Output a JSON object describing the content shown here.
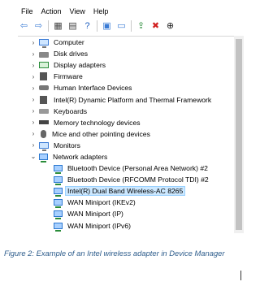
{
  "menu": [
    "File",
    "Action",
    "View",
    "Help"
  ],
  "toolbar": [
    {
      "name": "back-arrow-icon",
      "glyph": "⇦",
      "color": "#3a7bd5"
    },
    {
      "name": "forward-arrow-icon",
      "glyph": "⇨",
      "color": "#3a7bd5"
    },
    {
      "name": "show-hide-tree-icon",
      "glyph": "▦",
      "color": "#444444"
    },
    {
      "name": "properties-icon",
      "glyph": "▤",
      "color": "#444444"
    },
    {
      "name": "help-icon",
      "glyph": "?",
      "color": "#1f5fbf"
    },
    {
      "name": "view-grid-icon",
      "glyph": "▣",
      "color": "#3a7bd5"
    },
    {
      "name": "scan-hardware-icon",
      "glyph": "▭",
      "color": "#3a7bd5"
    },
    {
      "name": "update-driver-icon",
      "glyph": "⇪",
      "color": "#2a8c3a"
    },
    {
      "name": "uninstall-icon",
      "glyph": "✖",
      "color": "#d11f1f"
    },
    {
      "name": "download-icon",
      "glyph": "⊕",
      "color": "#222222"
    }
  ],
  "tree": {
    "categories": [
      {
        "label": "Computer",
        "icon": "monitor-icon"
      },
      {
        "label": "Disk drives",
        "icon": "disk-drive-icon"
      },
      {
        "label": "Display adapters",
        "icon": "display-adapter-icon"
      },
      {
        "label": "Firmware",
        "icon": "firmware-icon"
      },
      {
        "label": "Human Interface Devices",
        "icon": "hid-icon"
      },
      {
        "label": "Intel(R) Dynamic Platform and Thermal Framework",
        "icon": "chip-icon"
      },
      {
        "label": "Keyboards",
        "icon": "keyboard-icon"
      },
      {
        "label": "Memory technology devices",
        "icon": "memory-icon"
      },
      {
        "label": "Mice and other pointing devices",
        "icon": "mouse-icon"
      },
      {
        "label": "Monitors",
        "icon": "monitor-icon"
      },
      {
        "label": "Network adapters",
        "icon": "network-adapter-icon"
      }
    ],
    "network_children": [
      {
        "label": "Bluetooth Device (Personal Area Network) #2"
      },
      {
        "label": "Bluetooth Device (RFCOMM Protocol TDI) #2"
      },
      {
        "label": "Intel(R) Dual Band Wireless-AC 8265",
        "selected": true
      },
      {
        "label": "WAN Miniport (IKEv2)"
      },
      {
        "label": "WAN Miniport (IP)"
      },
      {
        "label": "WAN Miniport (IPv6)"
      }
    ]
  },
  "caption": "Figure 2: Example of an Intel wireless adapter in Device Manager"
}
